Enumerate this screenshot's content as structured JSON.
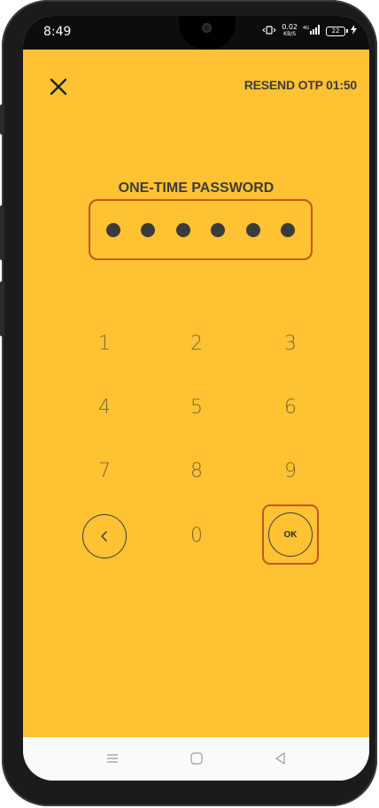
{
  "status_bar": {
    "time": "8:49",
    "net_speed_value": "0.02",
    "net_speed_unit": "KB/S",
    "network": "4G",
    "battery": "22"
  },
  "header": {
    "close_icon": "close-icon",
    "resend_label": "RESEND OTP 01:50"
  },
  "otp": {
    "title": "ONE-TIME PASSWORD",
    "digits_entered": 6,
    "highlight_color": "#C0591F"
  },
  "keypad": {
    "k1": "1",
    "k2": "2",
    "k3": "3",
    "k4": "4",
    "k5": "5",
    "k6": "6",
    "k7": "7",
    "k8": "8",
    "k9": "9",
    "k0": "0",
    "back_icon": "chevron-left-icon",
    "ok_label": "OK"
  },
  "nav_bar": {
    "menu_icon": "menu-icon",
    "home_icon": "home-icon",
    "back_icon": "back-triangle-icon"
  },
  "colors": {
    "background": "#FFC233",
    "text": "#3C3C3C",
    "highlight": "#C0591F"
  }
}
